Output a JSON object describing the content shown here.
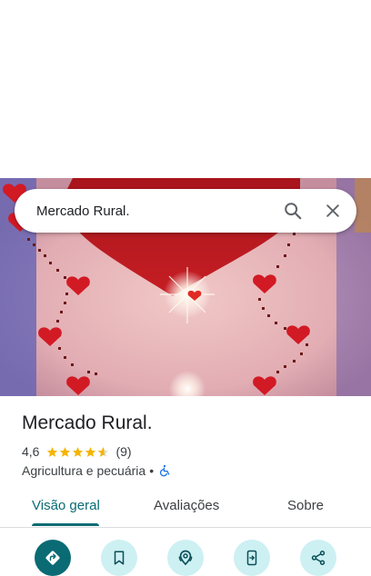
{
  "search": {
    "query": "Mercado Rural."
  },
  "place": {
    "name": "Mercado Rural.",
    "rating": "4,6",
    "stars": 4.6,
    "review_count": "(9)",
    "category": "Agricultura e pecuária",
    "separator": "•"
  },
  "tabs": [
    {
      "label": "Visão geral",
      "active": true
    },
    {
      "label": "Avaliações",
      "active": false
    },
    {
      "label": "Sobre",
      "active": false
    }
  ],
  "actions": [
    {
      "icon": "directions-icon"
    },
    {
      "icon": "bookmark-icon"
    },
    {
      "icon": "nearby-icon"
    },
    {
      "icon": "send-to-phone-icon"
    },
    {
      "icon": "share-icon"
    }
  ],
  "colors": {
    "accent": "#0a6b74",
    "action_bg": "#cdf0f3",
    "star": "#f5b400"
  }
}
